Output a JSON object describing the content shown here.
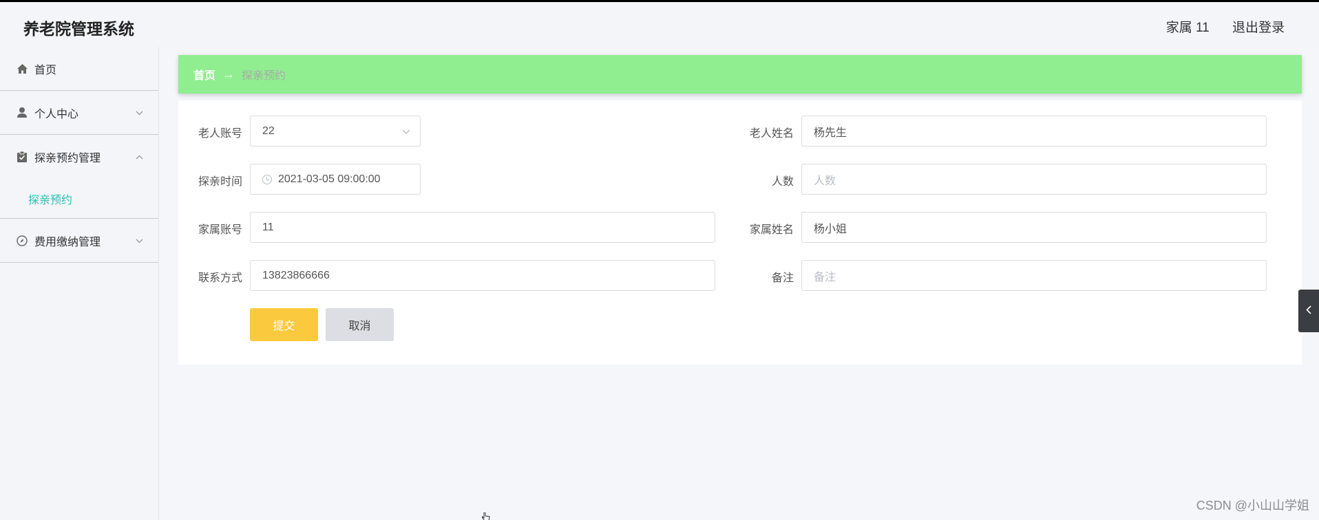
{
  "header": {
    "title": "养老院管理系统",
    "user": "家属 11",
    "logout": "退出登录"
  },
  "sidebar": {
    "items": [
      {
        "label": "首页",
        "icon": "home-icon"
      },
      {
        "label": "个人中心",
        "icon": "user-icon"
      },
      {
        "label": "探亲预约管理",
        "icon": "clipboard-icon"
      },
      {
        "label": "费用缴纳管理",
        "icon": "compass-icon"
      }
    ],
    "sub_item": "探亲预约"
  },
  "breadcrumb": {
    "home": "首页",
    "arrow": "→",
    "current": "探亲预约"
  },
  "form": {
    "elder_account": {
      "label": "老人账号",
      "value": "22"
    },
    "elder_name": {
      "label": "老人姓名",
      "value": "杨先生"
    },
    "visit_time": {
      "label": "探亲时间",
      "value": "2021-03-05 09:00:00"
    },
    "people": {
      "label": "人数",
      "placeholder": "人数"
    },
    "family_account": {
      "label": "家属账号",
      "value": "11"
    },
    "family_name": {
      "label": "家属姓名",
      "value": "杨小姐"
    },
    "contact": {
      "label": "联系方式",
      "value": "13823866666"
    },
    "remark": {
      "label": "备注",
      "placeholder": "备注"
    },
    "submit": "提交",
    "cancel": "取消"
  },
  "watermark": "CSDN @小山山学姐",
  "colors": {
    "breadcrumb_bg": "#90ee90",
    "submit_bg": "#fbc93d",
    "cancel_bg": "#dcdee3",
    "accent": "#2bc0b4"
  }
}
